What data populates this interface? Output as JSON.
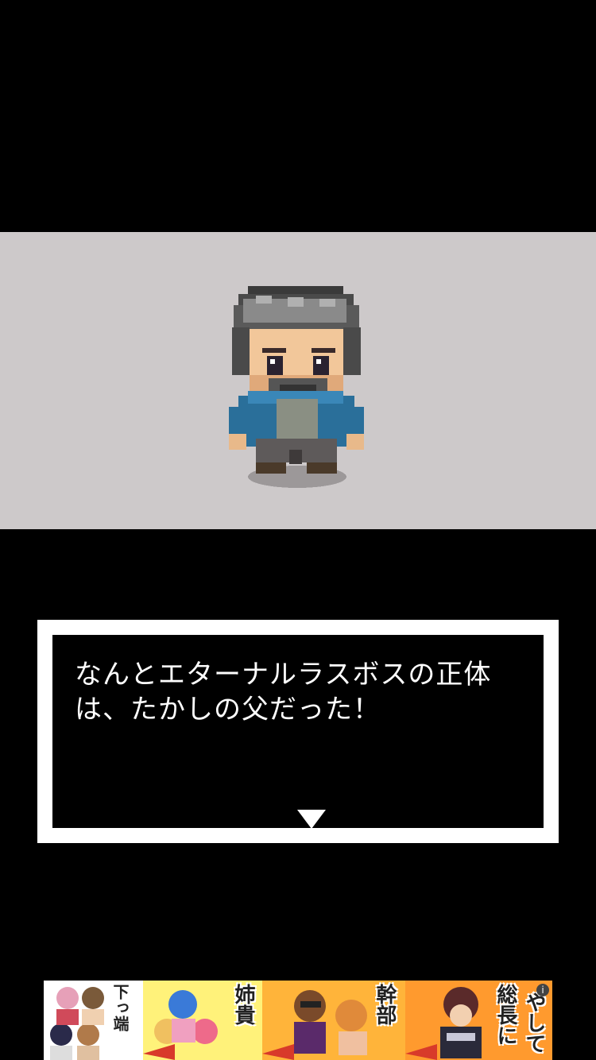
{
  "dialog": {
    "text": "なんとエターナルラスボスの正体\nは、たかしの父だった！",
    "advance_icon": "triangle-down"
  },
  "character": {
    "name_icon": "pixel-bearded-man"
  },
  "ad": {
    "panels": [
      {
        "caption": "下っ端"
      },
      {
        "caption": "姉貴"
      },
      {
        "caption": "幹部"
      },
      {
        "caption": "総長に"
      },
      {
        "caption": "やして"
      }
    ],
    "info_label": "i",
    "colors": {
      "panel1": "#ffffff",
      "panel2": "#fff27a",
      "panel3": "#ffb43a",
      "panel4": "#ff9a2e"
    }
  },
  "colors": {
    "scene_bg": "#cdc9ca",
    "background": "#000000",
    "dialog_border": "#ffffff"
  }
}
